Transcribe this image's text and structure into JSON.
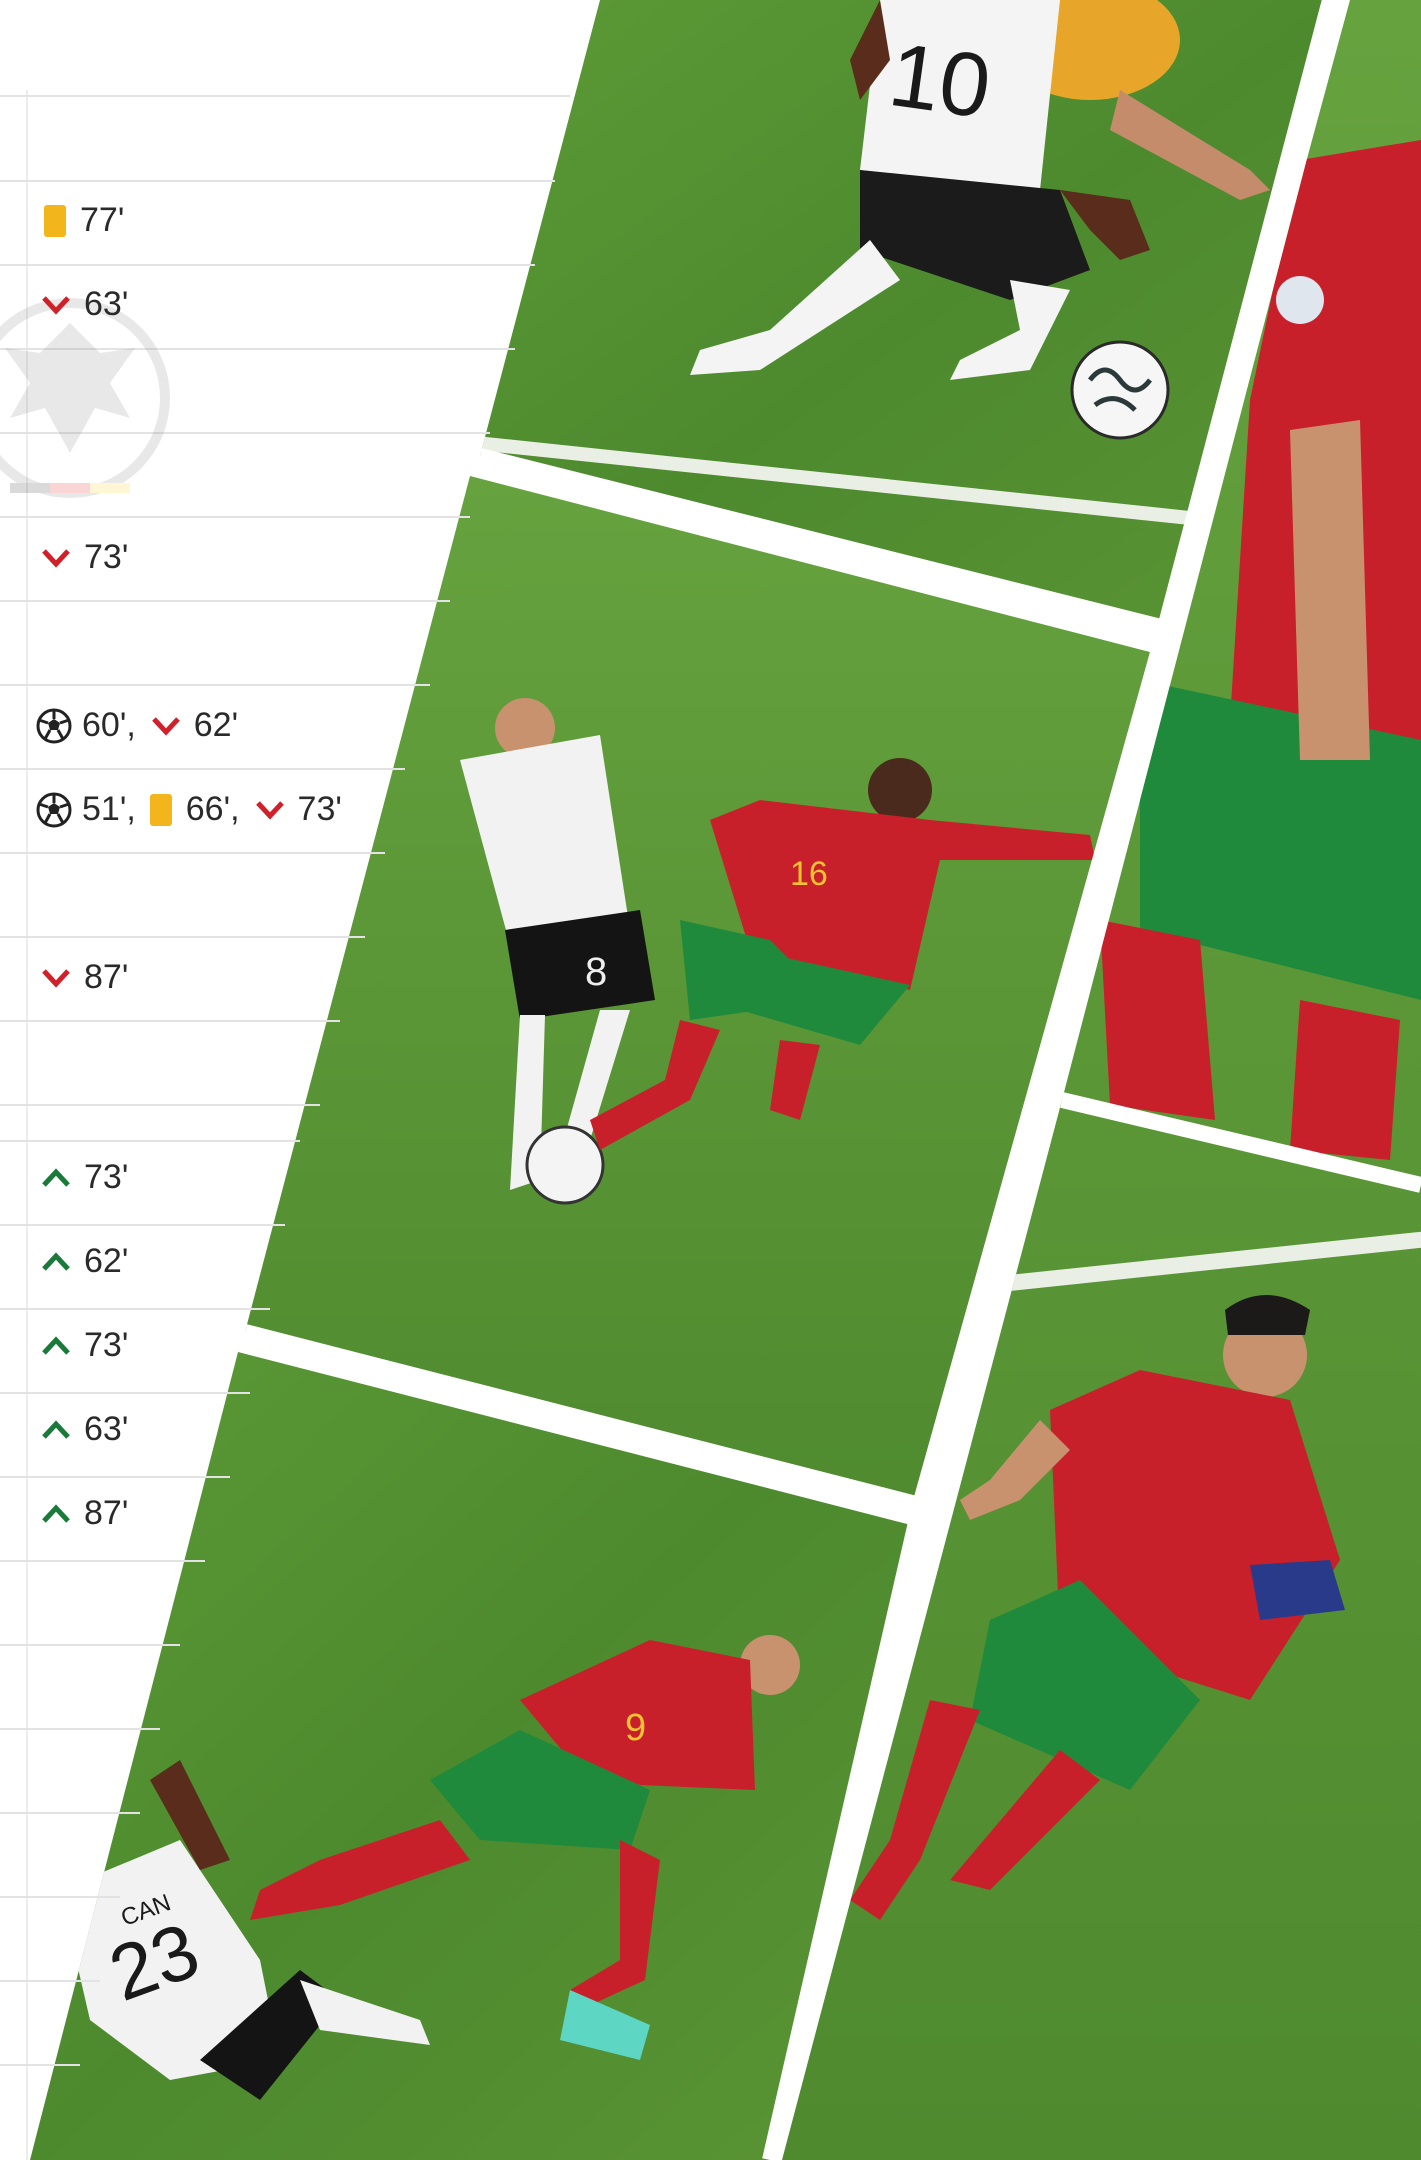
{
  "lineup_events": [
    {
      "row": "r1",
      "items": [
        {
          "icon": "yellow-card-icon",
          "minute": "77'"
        }
      ]
    },
    {
      "row": "r2",
      "items": [
        {
          "icon": "substitution-off-icon",
          "minute": "63'"
        }
      ]
    },
    {
      "row": "r3",
      "items": [
        {
          "icon": "substitution-off-icon",
          "minute": "73'"
        }
      ]
    },
    {
      "row": "r4",
      "items": [
        {
          "icon": "goal-icon",
          "minute": "60'"
        },
        {
          "icon": "substitution-off-icon",
          "minute": "62'"
        }
      ]
    },
    {
      "row": "r5",
      "items": [
        {
          "icon": "goal-icon",
          "minute": "51'"
        },
        {
          "icon": "yellow-card-icon",
          "minute": "66'"
        },
        {
          "icon": "substitution-off-icon",
          "minute": "73'"
        }
      ]
    },
    {
      "row": "r6",
      "items": [
        {
          "icon": "substitution-off-icon",
          "minute": "87'"
        }
      ]
    },
    {
      "row": "r7",
      "items": [
        {
          "icon": "substitution-on-icon",
          "minute": "73'"
        }
      ]
    },
    {
      "row": "r8",
      "items": [
        {
          "icon": "substitution-on-icon",
          "minute": "62'"
        }
      ]
    },
    {
      "row": "r9",
      "items": [
        {
          "icon": "substitution-on-icon",
          "minute": "73'"
        }
      ]
    },
    {
      "row": "r10",
      "items": [
        {
          "icon": "substitution-on-icon",
          "minute": "63'"
        }
      ]
    },
    {
      "row": "r11",
      "items": [
        {
          "icon": "substitution-on-icon",
          "minute": "87'"
        }
      ]
    }
  ],
  "photos": {
    "top": {
      "jersey_number": "10"
    },
    "middle": {
      "jersey_numbers": [
        "8",
        "16"
      ]
    },
    "bottom_left": {
      "jersey_number": "23",
      "name": "CAN",
      "opponent_number": "9"
    },
    "right": {}
  },
  "colors": {
    "pitch": "#4f8a2f",
    "pitch_light": "#6aa23e",
    "portugal_red": "#c8202a",
    "portugal_green": "#1f8a3b",
    "germany_white": "#f2f2f2",
    "card_yellow": "#f2b61c",
    "sub_off": "#d0202a",
    "sub_on": "#1a7a3a"
  }
}
